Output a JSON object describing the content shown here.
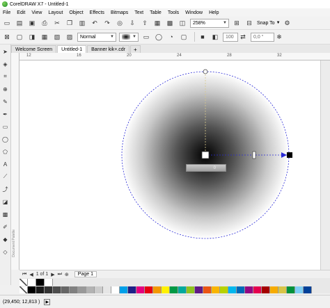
{
  "window": {
    "title": "CorelDRAW X7 - Untitled-1"
  },
  "menu": [
    "File",
    "Edit",
    "View",
    "Layout",
    "Object",
    "Effects",
    "Bitmaps",
    "Text",
    "Table",
    "Tools",
    "Window",
    "Help"
  ],
  "toolbar1": {
    "zoom": "258%",
    "snap_label": "Snap To"
  },
  "toolbar2": {
    "blend_mode": "Normal",
    "opacity": "100",
    "angle": "0,0 °"
  },
  "tabs": [
    "Welcome Screen",
    "Untitled-1",
    "Banner kik+.cdr"
  ],
  "active_tab": 1,
  "rulers": {
    "h_ticks": [
      "12",
      "16",
      "20",
      "24",
      "28",
      "32"
    ]
  },
  "side_label": "Document Palette",
  "transparency_readout": "0",
  "pagebar": {
    "page_count": "1 of 1",
    "page_tab": "Page 1"
  },
  "status": {
    "coords": "(29,450; 12,813 )"
  },
  "palette_colors_top": [
    "#ffffff",
    "#000000",
    "#ffffff"
  ],
  "palette_colors_bottom": [
    "#000000",
    "#1a1a1a",
    "#333333",
    "#4d4d4d",
    "#666666",
    "#808080",
    "#999999",
    "#b3b3b3",
    "#cccccc",
    "#e6e6e6",
    "#ffffff",
    "#00a0e9",
    "#1d2088",
    "#e4007f",
    "#e60012",
    "#f39800",
    "#fff100",
    "#009944",
    "#00a99d",
    "#8fc31f",
    "#601986",
    "#ea5514",
    "#f8b500",
    "#b8d200",
    "#00b7ee",
    "#0068b7",
    "#920783",
    "#e5004f",
    "#a40000",
    "#f6ab00",
    "#d7c447",
    "#00913a",
    "#7ecef4",
    "#004098"
  ],
  "colors": {
    "guide": "#2a2ad6",
    "handle": "#000000"
  }
}
